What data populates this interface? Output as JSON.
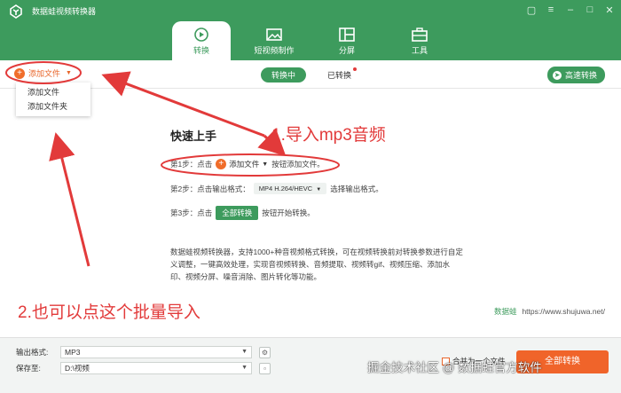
{
  "app": {
    "title": "数据蛙视频转换器"
  },
  "tabs": [
    {
      "label": "转换",
      "icon": "convert-icon",
      "active": true
    },
    {
      "label": "短视频制作",
      "icon": "image-icon"
    },
    {
      "label": "分屏",
      "icon": "split-screen-icon"
    },
    {
      "label": "工具",
      "icon": "toolbox-icon"
    }
  ],
  "toolbar": {
    "add_file_label": "添加文件",
    "seg_converting": "转换中",
    "seg_converted": "已转换",
    "fast_convert": "高速转换"
  },
  "dropdown": {
    "items": [
      "添加文件",
      "添加文件夹"
    ]
  },
  "quickstart": {
    "title": "快速上手",
    "step1": {
      "prefix": "第1步：点击",
      "button": "添加文件",
      "suffix": "按钮添加文件。"
    },
    "step2": {
      "prefix": "第2步：点击输出格式：",
      "format": "MP4 H.264/HEVC",
      "suffix": "选择输出格式。"
    },
    "step3": {
      "prefix": "第3步：点击",
      "button": "全部转换",
      "suffix": "按钮开始转换。"
    },
    "description": "数据蛙视频转换器，支持1000+种音视频格式转换，可在视频转换前对转换参数进行自定义调整，一键高效处理，实现音视频转换、音频提取、视频转gif、视频压缩、添加水印、视频分屏、噪音消除、图片转化等功能。",
    "brand": "数据蛙",
    "site": "https://www.shujuwa.net/"
  },
  "annotations": {
    "first": "1.导入mp3音频",
    "second": "2.也可以点这个批量导入"
  },
  "footer": {
    "output_format_label": "输出格式:",
    "output_format_value": "MP3",
    "save_to_label": "保存至:",
    "save_to_value": "D:\\视频",
    "merge_label": "合并为一个文件",
    "convert_all": "全部转换"
  },
  "watermark": "掘金技术社区 @ 数据蛙官方软件",
  "colors": {
    "brand_green": "#3d9b5d",
    "accent_orange": "#f0642a",
    "annotation_red": "#e23a3a"
  }
}
